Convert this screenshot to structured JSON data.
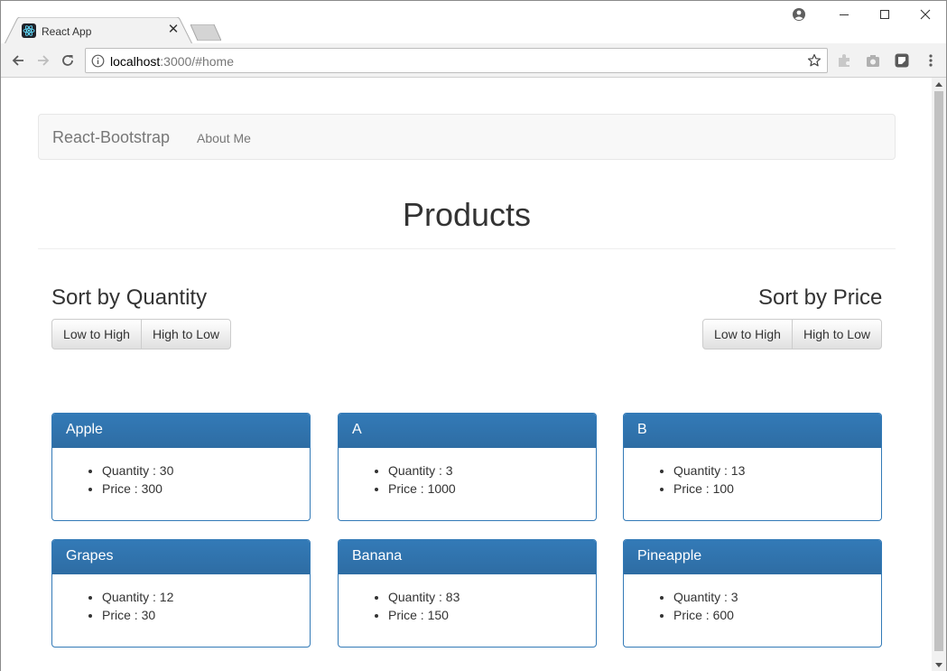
{
  "browser": {
    "tab_title": "React App",
    "url_host": "localhost",
    "url_path": ":3000/#home"
  },
  "navbar": {
    "brand": "React-Bootstrap",
    "links": [
      "About Me"
    ]
  },
  "header": {
    "title": "Products"
  },
  "sort": {
    "quantity": {
      "title": "Sort by Quantity",
      "low_to_high": "Low to High",
      "high_to_low": "High to Low"
    },
    "price": {
      "title": "Sort by Price",
      "low_to_high": "Low to High",
      "high_to_low": "High to Low"
    }
  },
  "products": [
    {
      "name": "Apple",
      "quantity": "Quantity : 30",
      "price": "Price : 300"
    },
    {
      "name": "A",
      "quantity": "Quantity : 3",
      "price": "Price : 1000"
    },
    {
      "name": "B",
      "quantity": "Quantity : 13",
      "price": "Price : 100"
    },
    {
      "name": "Grapes",
      "quantity": "Quantity : 12",
      "price": "Price : 30"
    },
    {
      "name": "Banana",
      "quantity": "Quantity : 83",
      "price": "Price : 150"
    },
    {
      "name": "Pineapple",
      "quantity": "Quantity : 3",
      "price": "Price : 600"
    }
  ],
  "colors": {
    "panel_primary": "#337ab7",
    "navbar_bg": "#f8f8f8"
  }
}
